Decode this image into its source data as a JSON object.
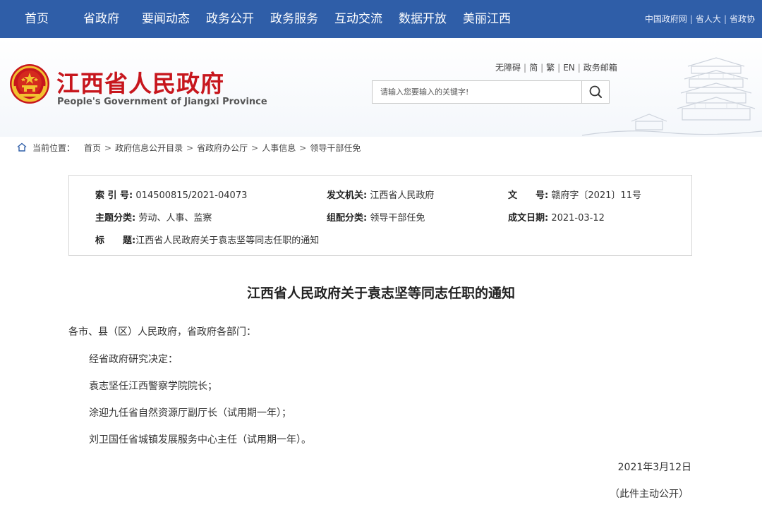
{
  "topnav": {
    "items": [
      "首页",
      "省政府",
      "要闻动态",
      "政务公开",
      "政务服务",
      "互动交流",
      "数据开放",
      "美丽江西"
    ],
    "links": [
      "中国政府网",
      "省人大",
      "省政协"
    ]
  },
  "header": {
    "title_cn": "江西省人民政府",
    "title_en": "People's Government of Jiangxi Province",
    "util_links": [
      "无障碍",
      "简",
      "繁",
      "EN",
      "政务邮箱"
    ],
    "search_placeholder": "请输入您要输入的关键字!"
  },
  "breadcrumb": {
    "label": "当前位置：",
    "path": [
      "首页",
      "政府信息公开目录",
      "省政府办公厅",
      "人事信息",
      "领导干部任免"
    ]
  },
  "meta": {
    "index_label": "索 引 号:",
    "index_value": "014500815/2021-04073",
    "issuer_label": "发文机关:",
    "issuer_value": "江西省人民政府",
    "doc_no_label": "文　　号:",
    "doc_no_value": "赣府字〔2021〕11号",
    "topic_label": "主题分类:",
    "topic_value": "劳动、人事、监察",
    "group_label": "组配分类:",
    "group_value": "领导干部任免",
    "date_label": "成文日期:",
    "date_value": "2021-03-12",
    "title_label": "标　　题:",
    "title_value": "江西省人民政府关于袁志坚等同志任职的通知"
  },
  "article": {
    "title": "江西省人民政府关于袁志坚等同志任职的通知",
    "salutation": "各市、县（区）人民政府，省政府各部门：",
    "paragraphs": [
      "经省政府研究决定：",
      "袁志坚任江西警察学院院长；",
      "涂迎九任省自然资源厅副厅长（试用期一年）；",
      "刘卫国任省城镇发展服务中心主任（试用期一年）。"
    ],
    "date": "2021年3月12日",
    "note": "（此件主动公开）"
  },
  "colors": {
    "nav_bg": "#2f5ea8",
    "title_red": "#c7161d"
  }
}
